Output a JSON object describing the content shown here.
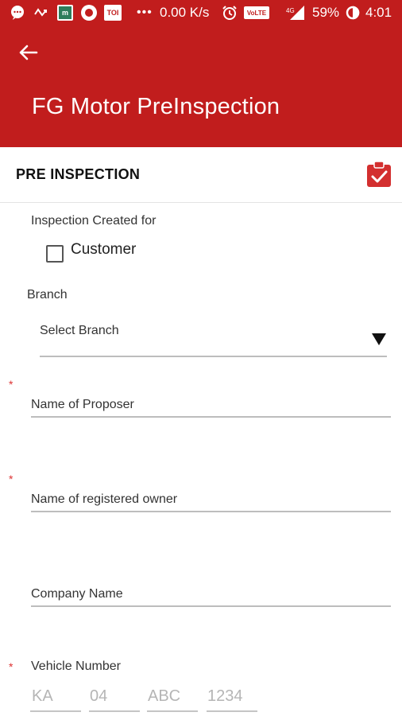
{
  "status_bar": {
    "net_speed": "0.00 K/s",
    "volte": "VoLTE",
    "network": "4G",
    "battery": "59%",
    "time": "4:01",
    "icons": [
      "message-icon",
      "missed-call-icon",
      "app-icon",
      "record-icon",
      "toi-icon",
      "more-icon",
      "alarm-icon",
      "volte-icon",
      "signal-icon",
      "battery-icon"
    ],
    "app_badge": "m",
    "toi_badge": "TOI"
  },
  "appbar": {
    "title": "FG Motor PreInspection",
    "color": "#c11d1d"
  },
  "section": {
    "title": "PRE INSPECTION",
    "action_icon": "clipboard-check-icon"
  },
  "form": {
    "inspection_for_label": "Inspection Created for",
    "customer_label": "Customer",
    "customer_checked": false,
    "branch_label": "Branch",
    "branch_select": "Select Branch",
    "proposer_placeholder": "Name of Proposer",
    "owner_placeholder": "Name of registered owner",
    "company_placeholder": "Company Name",
    "vehicle_label": "Vehicle Number",
    "vehicle_parts": [
      "KA",
      "04",
      "ABC",
      "1234"
    ],
    "required_mark": "*"
  }
}
